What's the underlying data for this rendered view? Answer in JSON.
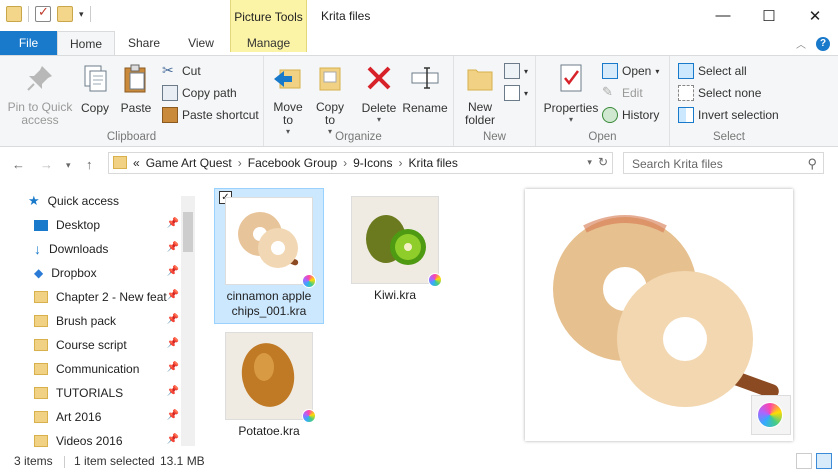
{
  "window": {
    "title": "Krita files",
    "context_tab": "Picture Tools"
  },
  "tabs": {
    "file": "File",
    "home": "Home",
    "share": "Share",
    "view": "View",
    "manage": "Manage"
  },
  "ribbon": {
    "clipboard": {
      "label": "Clipboard",
      "pin_to_quick_access": "Pin to Quick access",
      "copy": "Copy",
      "paste": "Paste",
      "cut": "Cut",
      "copy_path": "Copy path",
      "paste_shortcut": "Paste shortcut"
    },
    "organize": {
      "label": "Organize",
      "move_to": "Move to",
      "copy_to": "Copy to",
      "delete": "Delete",
      "rename": "Rename"
    },
    "new": {
      "label": "New",
      "new_folder": "New folder"
    },
    "open": {
      "label": "Open",
      "properties": "Properties",
      "open": "Open",
      "edit": "Edit",
      "history": "History"
    },
    "select": {
      "label": "Select",
      "select_all": "Select all",
      "select_none": "Select none",
      "invert_selection": "Invert selection"
    }
  },
  "address": {
    "overflow": "«",
    "breadcrumbs": [
      "Game Art Quest",
      "Facebook Group",
      "9-Icons",
      "Krita files"
    ],
    "search_placeholder": "Search Krita files"
  },
  "nav": {
    "items": [
      {
        "label": "Quick access",
        "icon": "star-icon"
      },
      {
        "label": "Desktop",
        "icon": "desktop-icon"
      },
      {
        "label": "Downloads",
        "icon": "download-icon"
      },
      {
        "label": "Dropbox",
        "icon": "dropbox-icon"
      },
      {
        "label": "Chapter 2 - New feat",
        "icon": "folder-icon"
      },
      {
        "label": "Brush pack",
        "icon": "folder-icon"
      },
      {
        "label": "Course script",
        "icon": "folder-icon"
      },
      {
        "label": "Communication",
        "icon": "folder-icon"
      },
      {
        "label": "TUTORIALS",
        "icon": "folder-icon"
      },
      {
        "label": "Art 2016",
        "icon": "folder-icon"
      },
      {
        "label": "Videos 2016",
        "icon": "folder-icon"
      }
    ]
  },
  "files": [
    {
      "name_line1": "cinnamon apple",
      "name_line2": "chips_001.kra",
      "selected": true
    },
    {
      "name_line1": "Kiwi.kra",
      "name_line2": "",
      "selected": false
    },
    {
      "name_line1": "Potatoe.kra",
      "name_line2": "",
      "selected": false
    }
  ],
  "status": {
    "items_count": "3 items",
    "selected": "1 item selected",
    "size": "13.1 MB"
  },
  "colors": {
    "accent": "#1979ca",
    "selection_bg": "#cce8ff",
    "context_tab_bg": "#fbf3a6"
  }
}
